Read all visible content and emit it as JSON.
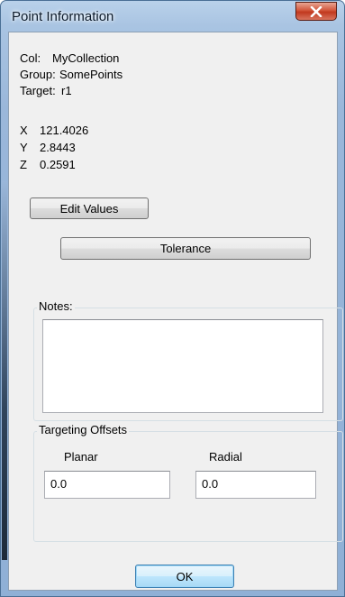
{
  "window": {
    "title": "Point Information"
  },
  "info": {
    "col_label": "Col:",
    "col_value": "MyCollection",
    "group_label": "Group:",
    "group_value": "SomePoints",
    "target_label": "Target:",
    "target_value": "r1"
  },
  "coords": {
    "x_label": "X",
    "x_value": "121.4026",
    "y_label": "Y",
    "y_value": "2.8443",
    "z_label": "Z",
    "z_value": "0.2591"
  },
  "buttons": {
    "edit_values": "Edit Values",
    "tolerance": "Tolerance",
    "ok": "OK"
  },
  "notes": {
    "label": "Notes:",
    "value": ""
  },
  "offsets": {
    "group_label": "Targeting Offsets",
    "planar_label": "Planar",
    "planar_value": "0.0",
    "radial_label": "Radial",
    "radial_value": "0.0"
  },
  "colors": {
    "close_button": "#c1391f",
    "focus_border": "#3c7fb1",
    "client_bg": "#f0f0f0"
  },
  "icons": {
    "close": "close-icon"
  }
}
